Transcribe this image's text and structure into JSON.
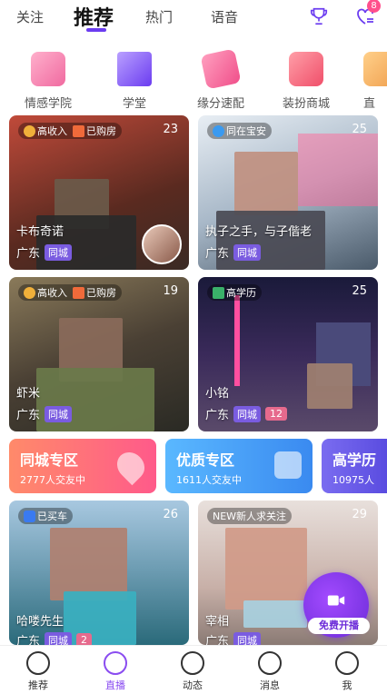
{
  "topnav": {
    "tabs": [
      {
        "label": "关注"
      },
      {
        "label": "推荐"
      },
      {
        "label": "热门"
      },
      {
        "label": "语音"
      }
    ],
    "notification_count": "8"
  },
  "shortcuts": [
    {
      "label": "情感学院",
      "icon": "house-heart-icon",
      "color": "#f06aa0"
    },
    {
      "label": "学堂",
      "icon": "graduation-cap-icon",
      "color": "#7a4cf0"
    },
    {
      "label": "缘分速配",
      "icon": "love-letter-icon",
      "color": "#f04f8a"
    },
    {
      "label": "装扮商城",
      "icon": "tshirt-icon",
      "color": "#f04f6a"
    },
    {
      "label": "直",
      "icon": "partial-icon",
      "color": "#f0a04f"
    }
  ],
  "cards": [
    {
      "tags": [
        "高收入",
        "已购房"
      ],
      "age": "23",
      "name": "卡布奇诺",
      "city": "广东",
      "pills": [
        "同城"
      ],
      "bg": "#7a3a2a"
    },
    {
      "tags": [
        "同在宝安"
      ],
      "age": "25",
      "name": "执子之手，与子偕老",
      "city": "广东",
      "pills": [
        "同城"
      ],
      "bg": "#8aa0b4"
    },
    {
      "tags": [
        "高收入",
        "已购房"
      ],
      "age": "19",
      "name": "虾米",
      "city": "广东",
      "pills": [
        "同城"
      ],
      "bg": "#5a4a3a"
    },
    {
      "tags": [
        "高学历"
      ],
      "age": "25",
      "name": "小铭",
      "city": "广东",
      "pills": [
        "同城",
        "12"
      ],
      "bg": "#2a2a4a"
    },
    {
      "tags": [
        "已买车"
      ],
      "age": "26",
      "name": "哈喽先生",
      "city": "广东",
      "pills": [
        "同城",
        "2"
      ],
      "bg": "#6a9ab0"
    },
    {
      "tags": [
        "NEW新人求关注"
      ],
      "age": "29",
      "name": "宰相",
      "city": "广东",
      "pills": [
        "同城"
      ],
      "bg": "#c8b0a8"
    }
  ],
  "zones": [
    {
      "title": "同城专区",
      "subtitle": "2777人交友中",
      "color": "#ff6b7a"
    },
    {
      "title": "优质专区",
      "subtitle": "1611人交友中",
      "color": "#4fa8ff"
    },
    {
      "title": "高学历",
      "subtitle": "10975人",
      "color": "#6a5cf0"
    }
  ],
  "live_button": {
    "label": "免费开播"
  },
  "bottomnav": [
    {
      "label": "推荐"
    },
    {
      "label": "直播"
    },
    {
      "label": "动态"
    },
    {
      "label": "消息"
    },
    {
      "label": "我"
    }
  ]
}
